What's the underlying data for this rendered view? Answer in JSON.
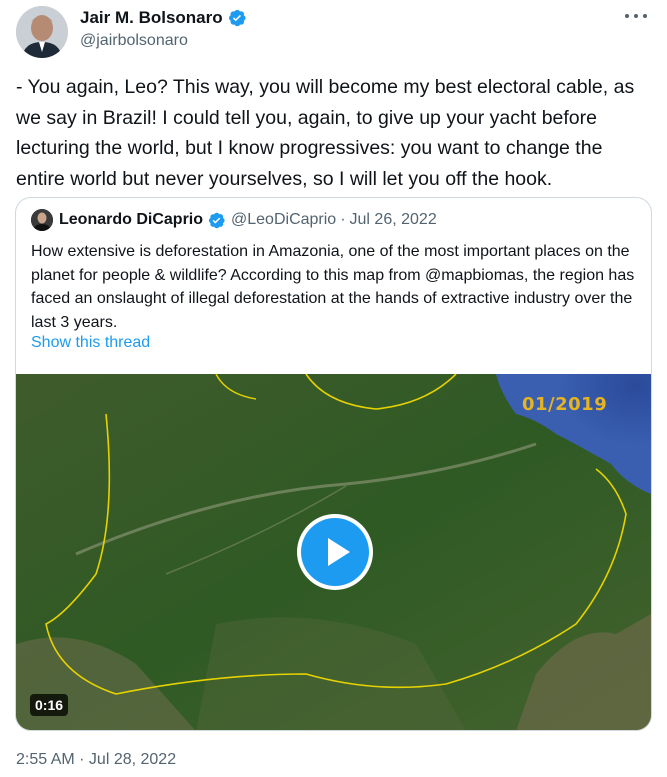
{
  "tweet": {
    "author_name": "Jair M. Bolsonaro",
    "author_handle": "@jairbolsonaro",
    "text": "- You again, Leo? This way, you will become my best electoral cable, as we say in Brazil! I could tell you, again, to give up your yacht before lecturing the world, but I know progressives: you want to change the entire world but never yourselves, so I will let you off the hook.",
    "timestamp": "2:55 AM · Jul 28, 2022",
    "more_icon": "ellipsis-icon"
  },
  "quoted": {
    "author_name": "Leonardo DiCaprio",
    "author_handle": "@LeoDiCaprio",
    "separator": "·",
    "date": "Jul 26, 2022",
    "text": "How extensive is deforestation in Amazonia, one of the most important places on the planet for people & wildlife? According to this map from @mapbiomas, the region has faced an onslaught of illegal deforestation at the hands of extractive industry over the last 3 years.",
    "show_thread": "Show this thread",
    "video": {
      "overlay_date": "01/2019",
      "duration": "0:16",
      "play_icon": "play-icon"
    }
  },
  "colors": {
    "verified": "#1d9bf0",
    "link": "#1d9bf0",
    "secondary_text": "#536471",
    "map_border": "#e6d200",
    "overlay_date": "#e6b422"
  }
}
